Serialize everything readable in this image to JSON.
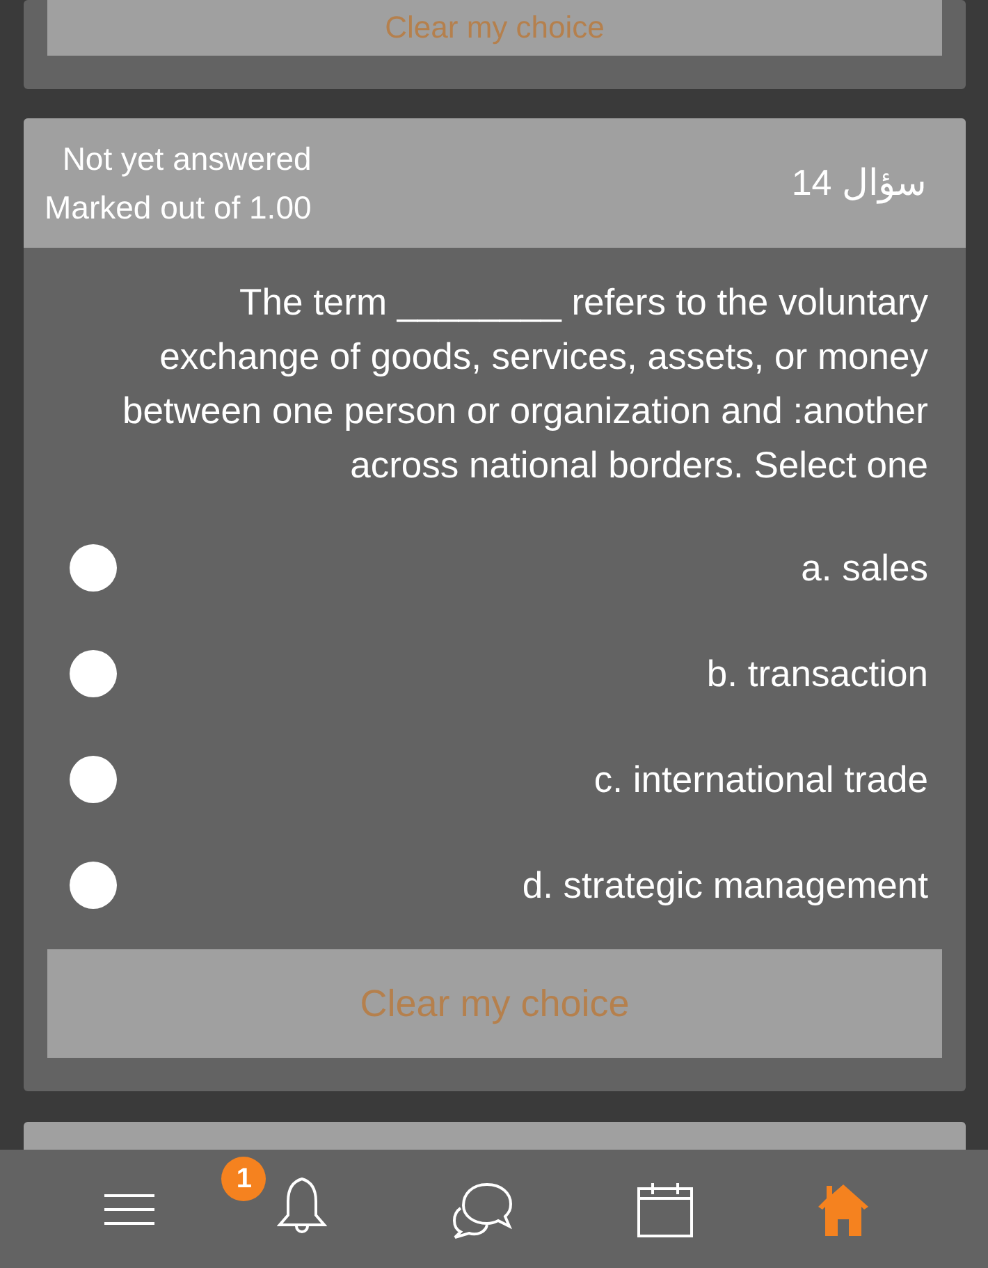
{
  "previous_question": {
    "clear_button": "Clear my choice"
  },
  "question": {
    "state": "Not yet answered",
    "marks": "Marked out of 1.00",
    "number": "سؤال 14",
    "text": "The term ________ refers to the voluntary exchange of goods, services, assets, or money between one person or organization and :another across national borders. Select one",
    "options": [
      {
        "label": "a. sales",
        "selected": false
      },
      {
        "label": "b. transaction",
        "selected": false
      },
      {
        "label": "c. international trade",
        "selected": false
      },
      {
        "label": "d. strategic management",
        "selected": false
      }
    ],
    "clear_button": "Clear my choice"
  },
  "bottom_nav": {
    "notification_count": "1"
  }
}
